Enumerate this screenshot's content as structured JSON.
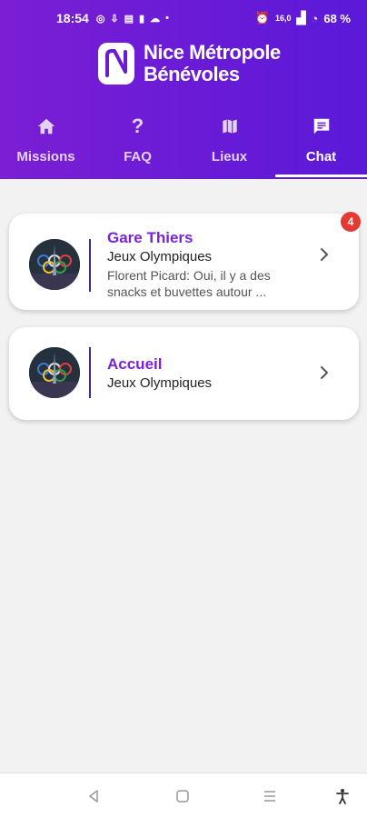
{
  "status_bar": {
    "time": "18:54",
    "speed": "16,0",
    "battery": "68 %"
  },
  "brand": {
    "line1": "Nice Métropole",
    "line2": "Bénévoles"
  },
  "tabs": [
    {
      "label": "Missions",
      "icon": "home-icon"
    },
    {
      "label": "FAQ",
      "icon": "question-icon"
    },
    {
      "label": "Lieux",
      "icon": "map-icon"
    },
    {
      "label": "Chat",
      "icon": "chat-icon",
      "active": true
    }
  ],
  "chats": [
    {
      "title": "Gare Thiers",
      "subtitle": "Jeux Olympiques",
      "preview_line1": "Florent Picard: Oui, il y a des",
      "preview_line2": "snacks et buvettes autour ...",
      "unread": "4"
    },
    {
      "title": "Accueil",
      "subtitle": "Jeux Olympiques"
    }
  ],
  "colors": {
    "brand_purple": "#7b22d8",
    "header_gradient": [
      "#7a1fd4",
      "#5a1ad8"
    ],
    "badge_red": "#e53935"
  }
}
